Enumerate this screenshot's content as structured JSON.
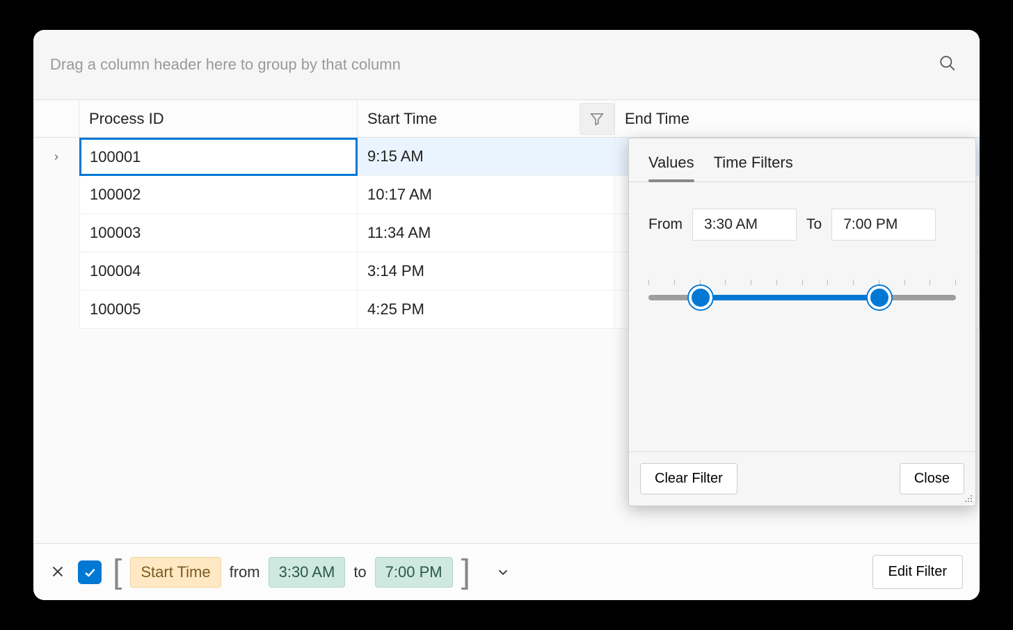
{
  "group_panel": {
    "text": "Drag a column header here to group by that column"
  },
  "columns": {
    "process_id": "Process ID",
    "start_time": "Start Time",
    "end_time": "End Time"
  },
  "rows": [
    {
      "process_id": "100001",
      "start_time": "9:15 AM"
    },
    {
      "process_id": "100002",
      "start_time": "10:17 AM"
    },
    {
      "process_id": "100003",
      "start_time": "11:34 AM"
    },
    {
      "process_id": "100004",
      "start_time": "3:14 PM"
    },
    {
      "process_id": "100005",
      "start_time": "4:25 PM"
    }
  ],
  "filter_popup": {
    "tabs": {
      "values": "Values",
      "time_filters": "Time Filters"
    },
    "from_label": "From",
    "to_label": "To",
    "from_value": "3:30 AM",
    "to_value": "7:00 PM",
    "slider": {
      "low_pct": 17,
      "high_pct": 75
    },
    "clear": "Clear Filter",
    "close": "Close"
  },
  "filter_bar": {
    "field": "Start Time",
    "from_word": "from",
    "to_word": "to",
    "from_value": "3:30 AM",
    "to_value": "7:00 PM",
    "edit": "Edit Filter"
  }
}
